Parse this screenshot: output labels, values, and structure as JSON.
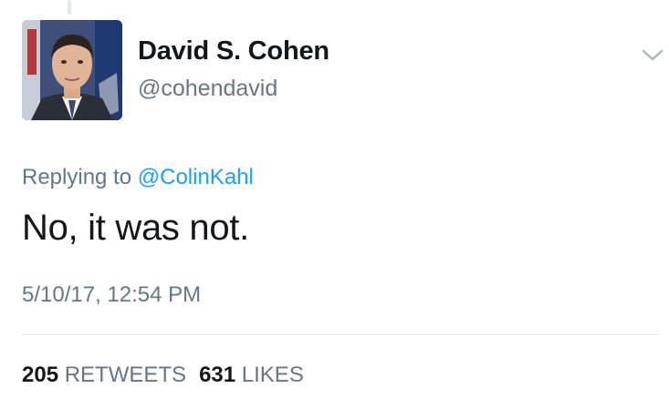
{
  "author": {
    "display_name": "David S. Cohen",
    "handle": "@cohendavid"
  },
  "reply": {
    "prefix": "Replying to",
    "mention": "@ColinKahl"
  },
  "tweet": {
    "text": "No, it was not.",
    "timestamp": "5/10/17, 12:54 PM"
  },
  "stats": {
    "retweets_count": "205",
    "retweets_label": "RETWEETS",
    "likes_count": "631",
    "likes_label": "LIKES"
  },
  "icons": {
    "menu": "chevron-down-icon"
  },
  "colors": {
    "link": "#1da1f2",
    "secondary_text": "#657786",
    "primary_text": "#14171a",
    "divider": "#e1e8ed"
  }
}
